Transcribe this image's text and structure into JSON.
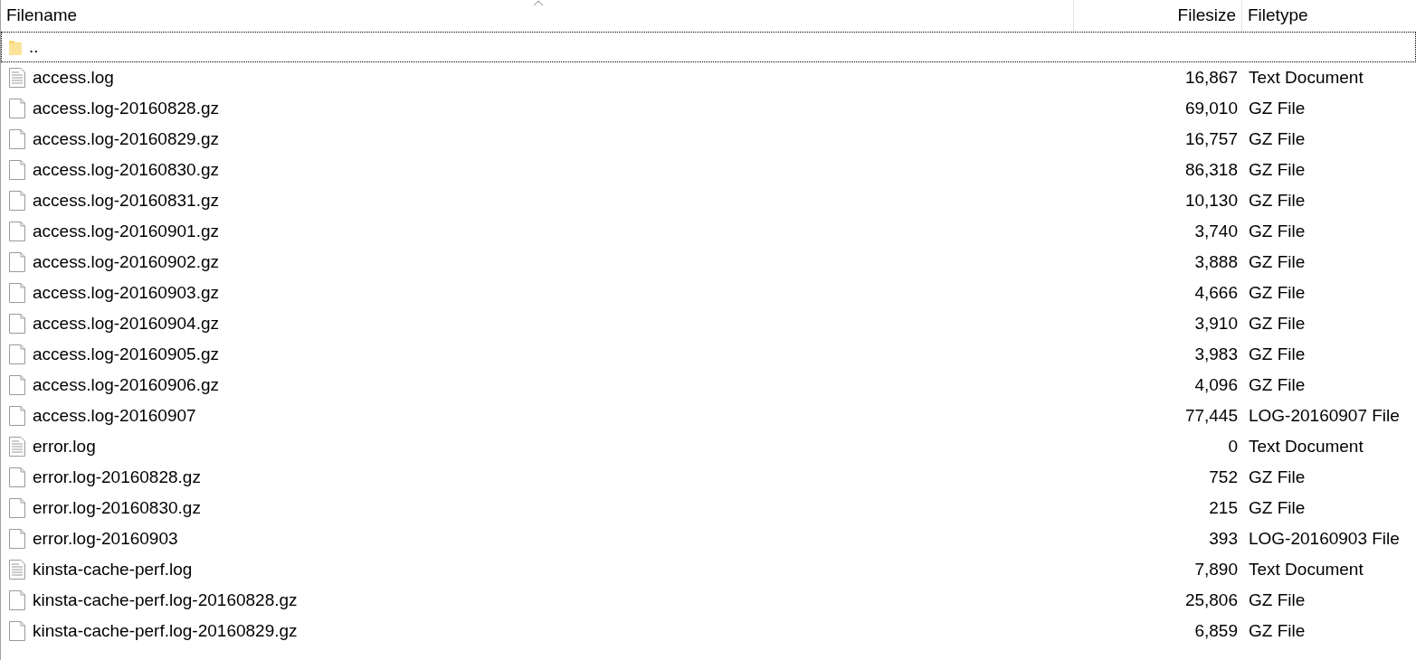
{
  "columns": [
    {
      "kind": "name",
      "label": "Filename"
    },
    {
      "kind": "size",
      "label": "Filesize"
    },
    {
      "kind": "type",
      "label": "Filetype"
    }
  ],
  "rows": [
    {
      "kind": "folder",
      "name": "..",
      "focused": true
    },
    {
      "kind": "text",
      "name": "access.log",
      "size": "16,867",
      "type": "Text Document",
      "focused": false
    },
    {
      "kind": "file",
      "name": "access.log-20160828.gz",
      "size": "69,010",
      "type": "GZ File",
      "focused": false
    },
    {
      "kind": "file",
      "name": "access.log-20160829.gz",
      "size": "16,757",
      "type": "GZ File",
      "focused": false
    },
    {
      "kind": "file",
      "name": "access.log-20160830.gz",
      "size": "86,318",
      "type": "GZ File",
      "focused": false
    },
    {
      "kind": "file",
      "name": "access.log-20160831.gz",
      "size": "10,130",
      "type": "GZ File",
      "focused": false
    },
    {
      "kind": "file",
      "name": "access.log-20160901.gz",
      "size": "3,740",
      "type": "GZ File",
      "focused": false
    },
    {
      "kind": "file",
      "name": "access.log-20160902.gz",
      "size": "3,888",
      "type": "GZ File",
      "focused": false
    },
    {
      "kind": "file",
      "name": "access.log-20160903.gz",
      "size": "4,666",
      "type": "GZ File",
      "focused": false
    },
    {
      "kind": "file",
      "name": "access.log-20160904.gz",
      "size": "3,910",
      "type": "GZ File",
      "focused": false
    },
    {
      "kind": "file",
      "name": "access.log-20160905.gz",
      "size": "3,983",
      "type": "GZ File",
      "focused": false
    },
    {
      "kind": "file",
      "name": "access.log-20160906.gz",
      "size": "4,096",
      "type": "GZ File",
      "focused": false
    },
    {
      "kind": "file",
      "name": "access.log-20160907",
      "size": "77,445",
      "type": "LOG-20160907 File",
      "focused": false
    },
    {
      "kind": "text",
      "name": "error.log",
      "size": "0",
      "type": "Text Document",
      "focused": false
    },
    {
      "kind": "file",
      "name": "error.log-20160828.gz",
      "size": "752",
      "type": "GZ File",
      "focused": false
    },
    {
      "kind": "file",
      "name": "error.log-20160830.gz",
      "size": "215",
      "type": "GZ File",
      "focused": false
    },
    {
      "kind": "file",
      "name": "error.log-20160903",
      "size": "393",
      "type": "LOG-20160903 File",
      "focused": false
    },
    {
      "kind": "text",
      "name": "kinsta-cache-perf.log",
      "size": "7,890",
      "type": "Text Document",
      "focused": false
    },
    {
      "kind": "file",
      "name": "kinsta-cache-perf.log-20160828.gz",
      "size": "25,806",
      "type": "GZ File",
      "focused": false
    },
    {
      "kind": "file",
      "name": "kinsta-cache-perf.log-20160829.gz",
      "size": "6,859",
      "type": "GZ File",
      "focused": false
    }
  ]
}
